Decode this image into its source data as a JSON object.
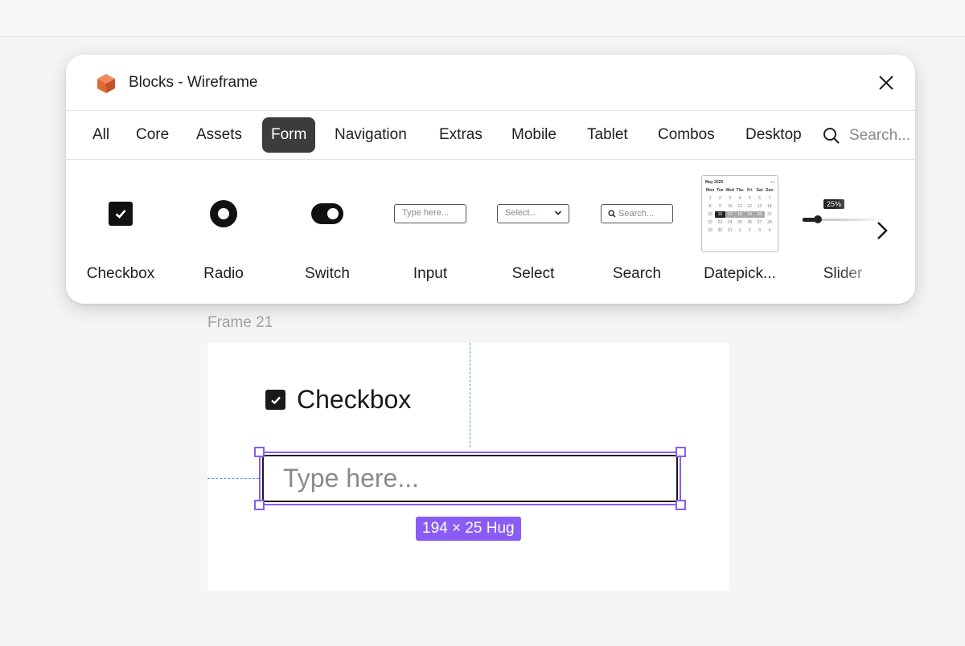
{
  "plugin": {
    "title": "Blocks - Wireframe",
    "logo_icon": "box-logo-icon",
    "brand_color": "#e0693a"
  },
  "tabs": [
    {
      "label": "All"
    },
    {
      "label": "Core"
    },
    {
      "label": "Assets"
    },
    {
      "label": "Form",
      "active": true
    },
    {
      "label": "Navigation"
    },
    {
      "label": "Extras"
    },
    {
      "label": "Mobile"
    },
    {
      "label": "Tablet"
    },
    {
      "label": "Combos"
    },
    {
      "label": "Desktop"
    }
  ],
  "search": {
    "placeholder": "Search..."
  },
  "blocks": [
    {
      "label": "Checkbox"
    },
    {
      "label": "Radio"
    },
    {
      "label": "Switch"
    },
    {
      "label": "Input",
      "preview_text": "Type here..."
    },
    {
      "label": "Select",
      "preview_text": "Select..."
    },
    {
      "label": "Search",
      "preview_text": "Search..."
    },
    {
      "label": "Datepick...",
      "preview_month": "May 2025",
      "preview_weekdays": [
        "Mon",
        "Tue",
        "Wed",
        "Thu",
        "Fri",
        "Sat",
        "Sun"
      ]
    },
    {
      "label": "Slider",
      "preview_value": "25%"
    }
  ],
  "canvas": {
    "frame_label": "Frame 21",
    "checkbox_label": "Checkbox",
    "input_placeholder": "Type here...",
    "size_badge": "194 × 25 Hug",
    "selection_color": "#8a5cf6",
    "guide_color": "#4a9fe0"
  }
}
